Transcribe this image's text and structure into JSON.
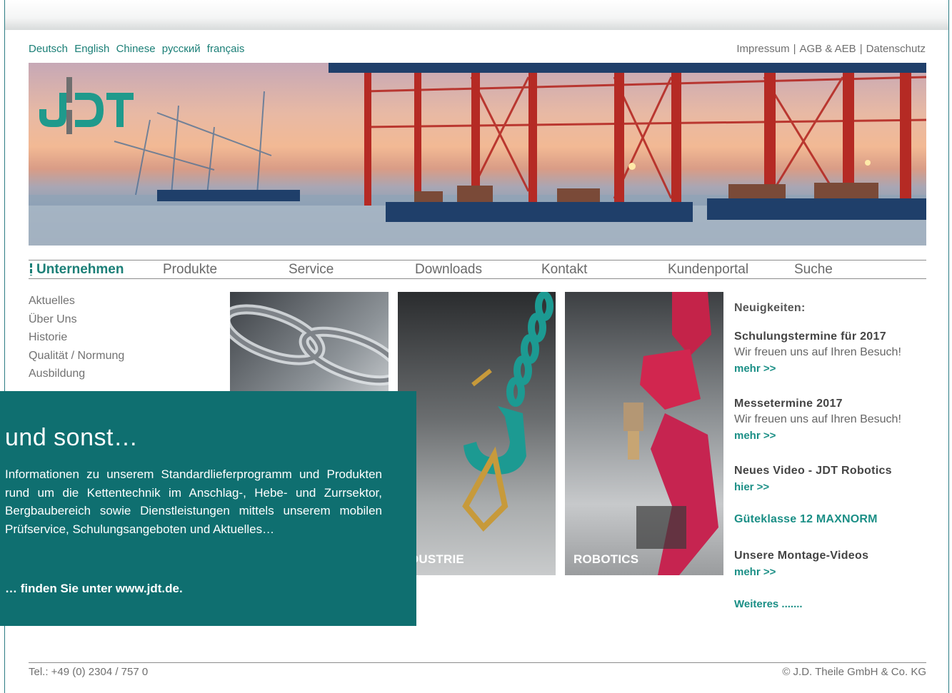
{
  "languages": [
    "Deutsch",
    "English",
    "Chinese",
    "русский",
    "français"
  ],
  "legal": [
    "Impressum",
    "AGB & AEB",
    "Datenschutz"
  ],
  "legal_separator": "|",
  "logo": {
    "text": "JDT"
  },
  "nav": {
    "items": [
      "Unternehmen",
      "Produkte",
      "Service",
      "Downloads",
      "Kontakt",
      "Kundenportal",
      "Suche"
    ],
    "active": "Unternehmen"
  },
  "subnav": [
    "Aktuelles",
    "Über Uns",
    "Historie",
    "Qualität / Normung",
    "Ausbildung"
  ],
  "tiles": [
    {
      "label": "",
      "icon": "chain-image"
    },
    {
      "label": "IDUSTRIE",
      "icon": "hook-image"
    },
    {
      "label": "ROBOTICS",
      "icon": "robot-image"
    }
  ],
  "news": {
    "heading": "Neuigkeiten:",
    "items": [
      {
        "title": "Schulungstermine für 2017",
        "text": "Wir freuen uns auf Ihren Besuch!",
        "link": "mehr >>"
      },
      {
        "title": "Messetermine 2017",
        "text": "Wir freuen uns auf Ihren Besuch!",
        "link": "mehr >>"
      },
      {
        "title": "Neues Video - JDT Robotics",
        "link": "hier >>"
      }
    ],
    "highlight": "Güteklasse 12 MAXNORM",
    "videos": {
      "title": "Unsere Montage-Videos",
      "link": "mehr >>"
    },
    "more": "Weiteres ......."
  },
  "overlay": {
    "title": "und sonst…",
    "body": "Informationen zu unserem Standardlieferprogramm und Produkten rund um die Kettentechnik im Anschlag-, Hebe- und Zurrsektor, Bergbaubereich sowie Dienstleistungen mittels unserem mobilen Prüfservice, Schulungsange­boten und Aktuelles…",
    "cta": "… finden Sie unter www.jdt.de."
  },
  "footer": {
    "phone": "Tel.: +49 (0) 2304 / 757 0",
    "copyright": "© J.D. Theile GmbH & Co. KG"
  },
  "colors": {
    "brand": "#1b7f77",
    "overlay": "#0f6f70",
    "link": "#1b8f86"
  }
}
